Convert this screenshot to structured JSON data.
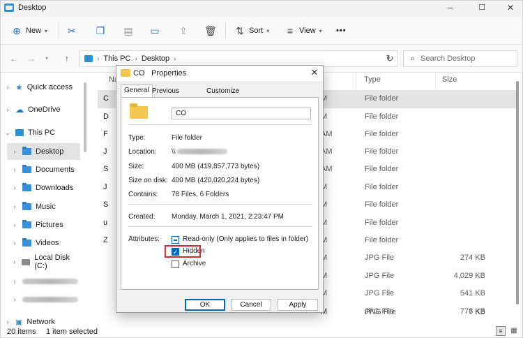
{
  "window": {
    "title": "Desktop",
    "controls": {
      "minimize": "–",
      "maximize": "☐",
      "close": "✕"
    }
  },
  "toolbar": {
    "new_label": "New",
    "sort_label": "Sort",
    "view_label": "View",
    "more_label": "•••"
  },
  "address": {
    "path": [
      "This PC",
      "Desktop"
    ],
    "search_placeholder": "Search Desktop"
  },
  "sidebar": {
    "items": [
      {
        "label": "Quick access",
        "icon": "star-icon"
      },
      {
        "label": "OneDrive",
        "icon": "cloud-icon"
      },
      {
        "label": "This PC",
        "icon": "computer-icon"
      },
      {
        "label": "Desktop",
        "icon": "folder-icon"
      },
      {
        "label": "Documents",
        "icon": "folder-icon"
      },
      {
        "label": "Downloads",
        "icon": "folder-icon"
      },
      {
        "label": "Music",
        "icon": "folder-icon"
      },
      {
        "label": "Pictures",
        "icon": "folder-icon"
      },
      {
        "label": "Videos",
        "icon": "folder-icon"
      },
      {
        "label": "Local Disk (C:)",
        "icon": "drive-icon"
      },
      {
        "label": "Network",
        "icon": "network-icon"
      }
    ]
  },
  "list": {
    "columns": {
      "name": "Na",
      "type": "Type",
      "size": "Size"
    },
    "rows": [
      {
        "name": "C",
        "date": "M",
        "type": "File folder",
        "size": ""
      },
      {
        "name": "D",
        "date": "M",
        "type": "File folder",
        "size": ""
      },
      {
        "name": "F",
        "date": "AM",
        "type": "File folder",
        "size": ""
      },
      {
        "name": "J",
        "date": "AM",
        "type": "File folder",
        "size": ""
      },
      {
        "name": "S",
        "date": "AM",
        "type": "File folder",
        "size": ""
      },
      {
        "name": "J",
        "date": "M",
        "type": "File folder",
        "size": ""
      },
      {
        "name": "S",
        "date": "M",
        "type": "File folder",
        "size": ""
      },
      {
        "name": "u",
        "date": "M",
        "type": "File folder",
        "size": ""
      },
      {
        "name": "Z",
        "date": "M",
        "type": "File folder",
        "size": ""
      },
      {
        "name": "",
        "date": "M",
        "type": "JPG File",
        "size": "274 KB"
      },
      {
        "name": "",
        "date": "M",
        "type": "JPG File",
        "size": "4,029 KB"
      },
      {
        "name": "",
        "date": "M",
        "type": "JPG File",
        "size": "541 KB"
      },
      {
        "name": "",
        "date": "M",
        "type": "JPG File",
        "size": "778 KB"
      },
      {
        "name": "",
        "date": "M",
        "type": "PNG File",
        "size": "7 KB"
      }
    ]
  },
  "status": {
    "items": "20 items",
    "selected": "1 item selected"
  },
  "dialog": {
    "title_folder": "CO",
    "title": "Properties",
    "tabs": [
      "General",
      "Previous Versions",
      "Customize"
    ],
    "name_value": "CO",
    "type_label": "Type:",
    "type_value": "File folder",
    "location_label": "Location:",
    "location_value": "\\\\",
    "size_label": "Size:",
    "size_value": "400 MB (419,857,773 bytes)",
    "size_on_disk_label": "Size on disk:",
    "size_on_disk_value": "400 MB (420,020,224 bytes)",
    "contains_label": "Contains:",
    "contains_value": "78 Files, 6 Folders",
    "created_label": "Created:",
    "created_value": "Monday, March 1, 2021, 2:23:47 PM",
    "attributes_label": "Attributes:",
    "readonly_label": "Read-only (Only applies to files in folder)",
    "hidden_label": "Hidden",
    "archive_label": "Archive",
    "ok": "OK",
    "cancel": "Cancel",
    "apply": "Apply"
  }
}
